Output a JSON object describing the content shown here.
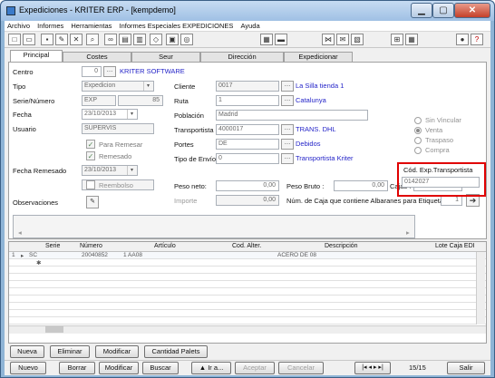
{
  "window": {
    "title": "Expediciones - KRITER ERP - [kempdemo]"
  },
  "menu": [
    "Archivo",
    "Informes",
    "Herramientas",
    "Informes Especiales EXPEDICIONES",
    "Ayuda"
  ],
  "tabs": [
    "Principal",
    "Costes",
    "Seur",
    "Dirección",
    "Expedicionar"
  ],
  "form": {
    "centro": {
      "label": "Centro",
      "value": "0",
      "link": "KRITER SOFTWARE"
    },
    "tipo": {
      "label": "Tipo",
      "value": "Expedicion"
    },
    "serie": {
      "label": "Serie/Número",
      "value": "EXP",
      "numero": "85"
    },
    "fecha": {
      "label": "Fecha",
      "value": "23/10/2013"
    },
    "usuario": {
      "label": "Usuario",
      "value": "SUPERVIS"
    },
    "para_remesar": "Para Remesar",
    "remesado": "Remesado",
    "fecha_remesado": {
      "label": "Fecha Remesado",
      "value": "23/10/2013"
    },
    "reembolso": "Reembolso",
    "observaciones": "Observaciones",
    "cliente": {
      "label": "Cliente",
      "value": "0017",
      "link": "La Silla tienda 1"
    },
    "ruta": {
      "label": "Ruta",
      "value": "1",
      "link": "Catalunya"
    },
    "poblacion": {
      "label": "Población",
      "value": "Madrid"
    },
    "transportista": {
      "label": "Transportista",
      "value": "4000017",
      "link": "TRANS. DHL"
    },
    "portes": {
      "label": "Portes",
      "value": "DE",
      "link": "Debidos"
    },
    "tipo_envio": {
      "label": "Tipo de Envío",
      "value": "0",
      "link": "Transportista Kriter"
    },
    "vinculo_options": [
      "Sin Vincular",
      "Venta",
      "Traspaso",
      "Compra"
    ],
    "cod_exp": {
      "label": "Cód. Exp.Transportista",
      "value": "0142027"
    },
    "peso_neto": {
      "label": "Peso neto:",
      "value": "0,00"
    },
    "importe": {
      "label": "Importe",
      "value": "0,00"
    },
    "peso_bruto": {
      "label": "Peso Bruto :",
      "value": "0,00"
    },
    "cajas": {
      "label": "Cajas :",
      "value": "1,00"
    },
    "num_caja": {
      "label": "Núm. de Caja que contiene Albaranes para Etiquetas",
      "value": "1"
    }
  },
  "grid": {
    "headers": [
      "Serie",
      "Número",
      "Artículo",
      "Cod. Alter.",
      "Descripción",
      "Lote Caja EDI"
    ],
    "row": {
      "idx": "1",
      "marker": "▸",
      "serie": "SC",
      "numero": "20040852",
      "articulo": "1 AA08",
      "descripcion": "ACERO DE 08"
    },
    "new_row_marker": "✱"
  },
  "grid_buttons": [
    "Nueva",
    "Eliminar",
    "Modificar",
    "Cantidad Palets"
  ],
  "bottom_buttons": [
    "Nuevo",
    "Borrar",
    "Modificar",
    "Buscar",
    "▲ Ir a...",
    "Aceptar",
    "Cancelar",
    "Salir"
  ],
  "nav": {
    "record": "15/15"
  }
}
